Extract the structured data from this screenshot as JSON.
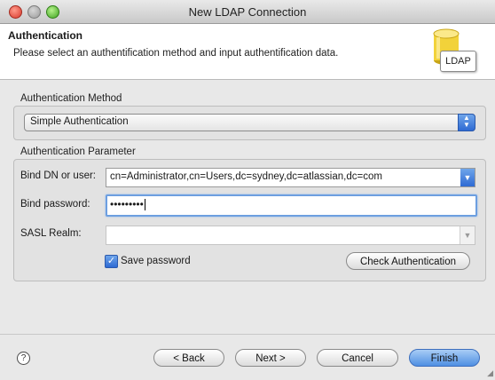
{
  "window": {
    "title": "New LDAP Connection"
  },
  "banner": {
    "title": "Authentication",
    "description": "Please select an authentification method and input authentification data.",
    "icon_label": "LDAP"
  },
  "method": {
    "group_label": "Authentication Method",
    "selected": "Simple Authentication"
  },
  "params": {
    "group_label": "Authentication Parameter",
    "bind_dn_label": "Bind DN or user:",
    "bind_dn_value": "cn=Administrator,cn=Users,dc=sydney,dc=atlassian,dc=com",
    "bind_password_label": "Bind password:",
    "bind_password_value": "•••••••••",
    "sasl_label": "SASL Realm:",
    "sasl_value": "",
    "save_password_label": "Save password",
    "save_password_checked": true,
    "check_auth_label": "Check Authentication"
  },
  "footer": {
    "back_label": "< Back",
    "next_label": "Next >",
    "cancel_label": "Cancel",
    "finish_label": "Finish",
    "help_glyph": "?"
  }
}
